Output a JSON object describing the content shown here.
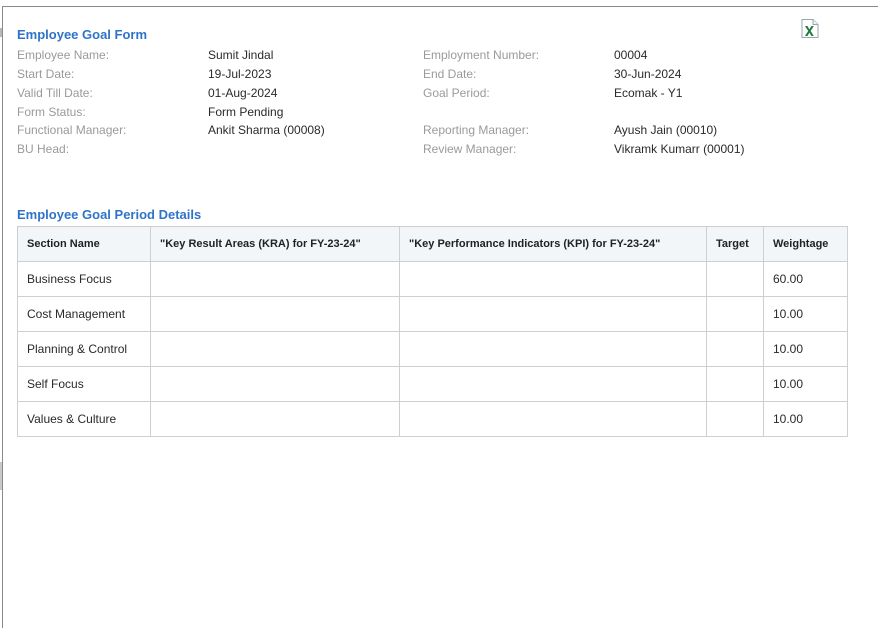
{
  "form": {
    "title": "Employee Goal Form",
    "export_icon": "excel-icon",
    "fields": [
      {
        "left_label": "Employee Name:",
        "left_value": "Sumit Jindal",
        "right_label": "Employment Number:",
        "right_value": "00004"
      },
      {
        "left_label": "Start Date:",
        "left_value": "19-Jul-2023",
        "right_label": "End Date:",
        "right_value": "30-Jun-2024"
      },
      {
        "left_label": "Valid Till Date:",
        "left_value": "01-Aug-2024",
        "right_label": "Goal Period:",
        "right_value": "Ecomak - Y1"
      },
      {
        "left_label": "Form Status:",
        "left_value": "Form Pending",
        "right_label": "",
        "right_value": ""
      },
      {
        "left_label": "Functional Manager:",
        "left_value": "Ankit Sharma (00008)",
        "right_label": "Reporting Manager:",
        "right_value": "Ayush Jain (00010)"
      },
      {
        "left_label": "BU Head:",
        "left_value": "",
        "right_label": "Review Manager:",
        "right_value": "Vikramk Kumarr (00001)"
      }
    ]
  },
  "details": {
    "title": "Employee Goal Period Details",
    "columns": [
      "Section Name",
      "\"Key Result Areas (KRA) for FY-23-24\"",
      "\"Key Performance Indicators (KPI) for FY-23-24\"",
      "Target",
      "Weightage"
    ],
    "rows": [
      {
        "section": "Business Focus",
        "kra": "",
        "kpi": "",
        "target": "",
        "weightage": "60.00"
      },
      {
        "section": "Cost Management",
        "kra": "",
        "kpi": "",
        "target": "",
        "weightage": "10.00"
      },
      {
        "section": "Planning & Control",
        "kra": "",
        "kpi": "",
        "target": "",
        "weightage": "10.00"
      },
      {
        "section": "Self Focus",
        "kra": "",
        "kpi": "",
        "target": "",
        "weightage": "10.00"
      },
      {
        "section": "Values & Culture",
        "kra": "",
        "kpi": "",
        "target": "",
        "weightage": "10.00"
      }
    ]
  },
  "colors": {
    "accent": "#2f73c9",
    "label": "#9a9a9a",
    "header_bg": "#f2f6f9",
    "excel_green": "#1d7a3a"
  }
}
